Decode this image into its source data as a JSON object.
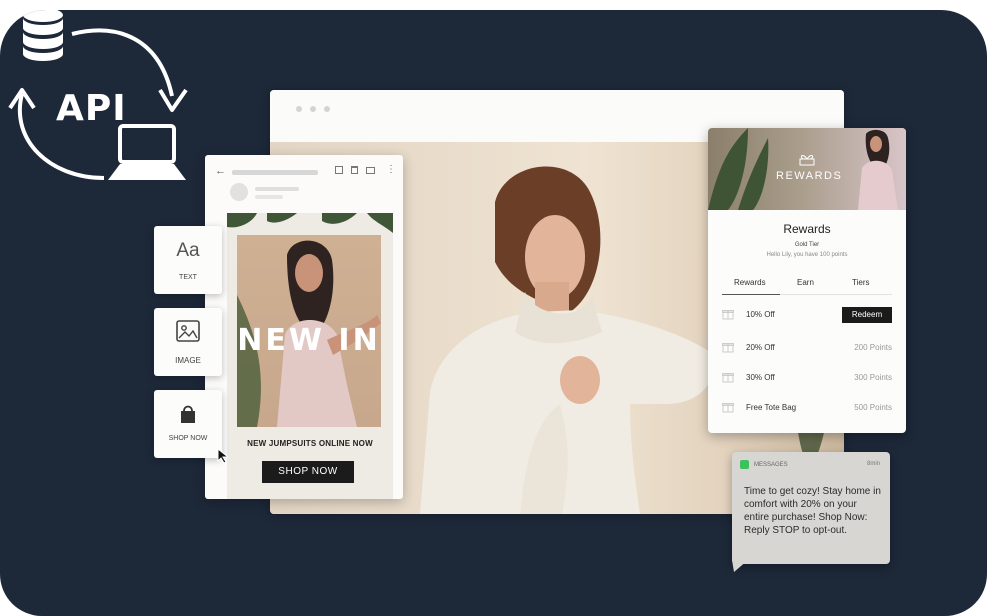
{
  "api": {
    "label": "API"
  },
  "email": {
    "headline": "NEW IN",
    "subhead": "NEW JUMPSUITS ONLINE NOW",
    "cta": "SHOP NOW"
  },
  "tools": {
    "text_glyph": "Aa",
    "text_label": "TEXT",
    "image_label": "IMAGE",
    "shop_label": "SHOP NOW"
  },
  "rewards": {
    "banner": "REWARDS",
    "title": "Rewards",
    "tier": "Gold Tier",
    "hello": "Hello Lily, you have 100 points",
    "tabs": [
      "Rewards",
      "Earn",
      "Tiers"
    ],
    "items": [
      {
        "name": "10% Off",
        "value": "Redeem"
      },
      {
        "name": "20% Off",
        "value": "200 Points"
      },
      {
        "name": "30% Off",
        "value": "300 Points"
      },
      {
        "name": "Free Tote Bag",
        "value": "500 Points"
      }
    ]
  },
  "sms": {
    "app": "MESSAGES",
    "time": "8min",
    "text": "Time to get cozy! Stay home in comfort with 20% on your entire purchase! Shop Now: Reply STOP to opt-out."
  },
  "colors": {
    "background": "#1d2839",
    "button": "#1b1b1b",
    "sms_icon": "#3cc25c"
  }
}
